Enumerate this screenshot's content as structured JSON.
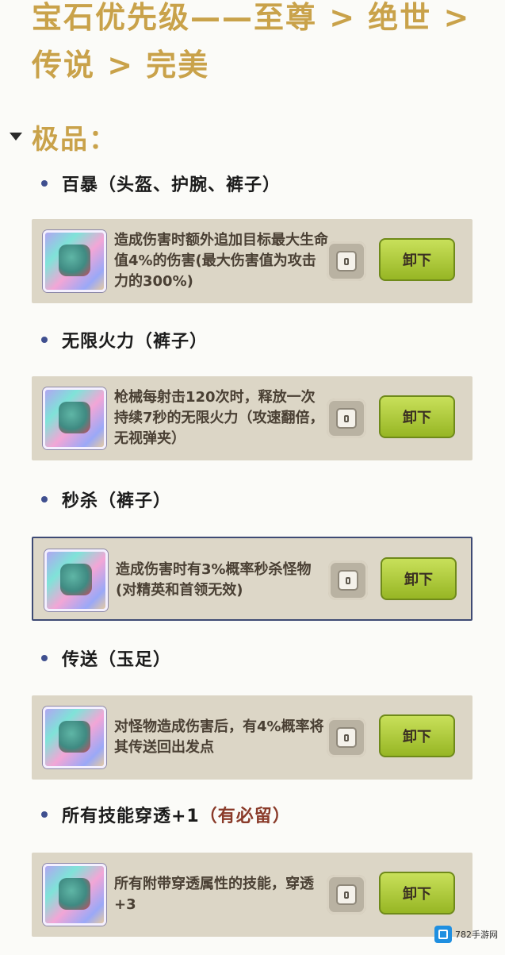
{
  "title": "宝石优先级——至尊 > 绝世 > 传说 > 完美",
  "section": {
    "label": "极品："
  },
  "action_label": "卸下",
  "items": [
    {
      "name": "百暴（头盔、护腕、裤子）",
      "note": "",
      "description": "造成伤害时额外追加目标最大生命值4%的伤害(最大伤害值为攻击力的300%)"
    },
    {
      "name": "无限火力（裤子）",
      "note": "",
      "description": "枪械每射击120次时，释放一次持续7秒的无限火力（攻速翻倍，无视弹夹）"
    },
    {
      "name": "秒杀（裤子）",
      "note": "",
      "description": "造成伤害时有3%概率秒杀怪物(对精英和首领无效)"
    },
    {
      "name": "传送（玉足）",
      "note": "",
      "description": "对怪物造成伤害后，有4%概率将其传送回出发点"
    },
    {
      "name": "所有技能穿透+1",
      "note": "（有必留）",
      "description": "所有附带穿透属性的技能，穿透+3"
    }
  ],
  "watermark": {
    "text": "782手游网"
  }
}
